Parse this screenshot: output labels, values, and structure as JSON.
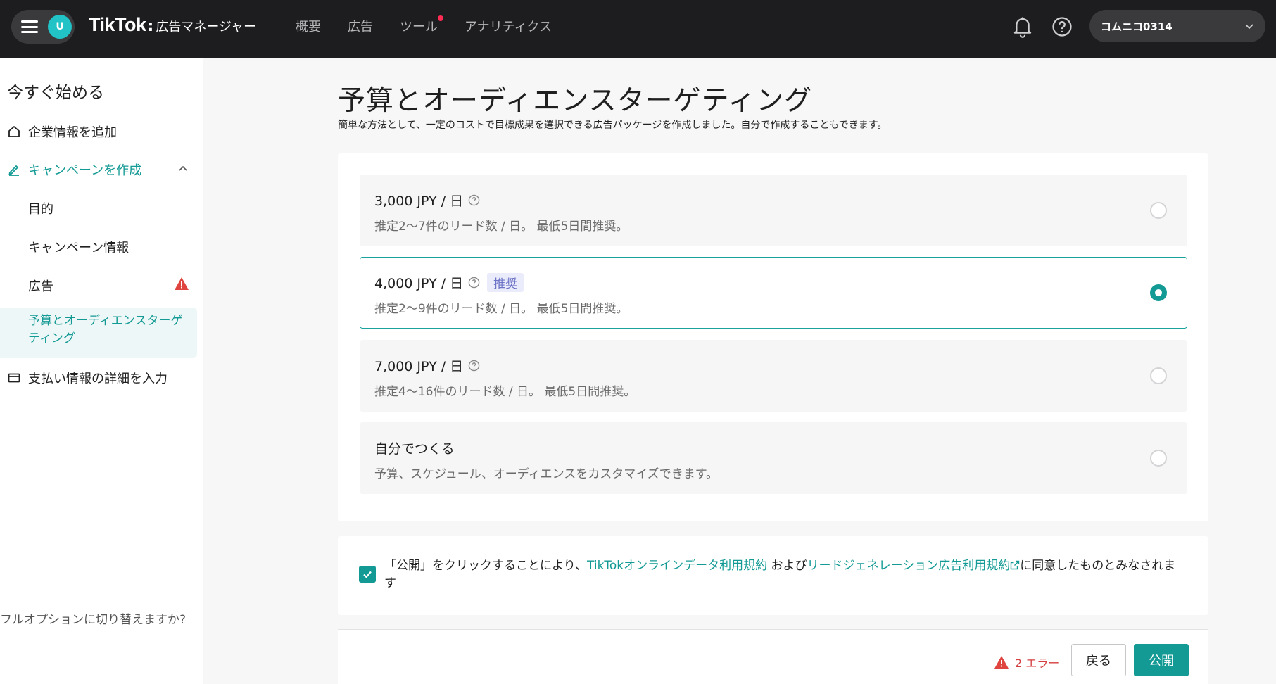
{
  "header": {
    "avatar_letter": "U",
    "brand_name": "TikTok",
    "brand_separator": ":",
    "brand_sub": "広告マネージャー",
    "nav": [
      "概要",
      "広告",
      "ツール",
      "アナリティクス"
    ],
    "account_name": "コムニコ0314",
    "icons": [
      "menu-icon",
      "bell-icon",
      "help-icon",
      "chevron-down-icon"
    ]
  },
  "sidebar": {
    "title": "今すぐ始める",
    "company_info": "企業情報を追加",
    "create_campaign": "キャンペーンを作成",
    "sub_items": [
      "目的",
      "キャンペーン情報",
      "広告"
    ],
    "active_item": "予算とオーディエンスターゲティング",
    "payment": "支払い情報の詳細を入力",
    "switch_text": "フルオプションに切り替えますか?"
  },
  "main": {
    "title": "予算とオーディエンスターゲティング",
    "subtitle": "簡単な方法として、一定のコストで目標成果を選択できる広告パッケージを作成しました。自分で作成することもできます。",
    "options": [
      {
        "title": "3,000 JPY / 日",
        "desc": "推定2～7件のリード数 / 日。 最低5日間推奨。",
        "selected": false
      },
      {
        "title": "4,000 JPY / 日",
        "badge": "推奨",
        "desc": "推定2～9件のリード数 / 日。 最低5日間推奨。",
        "selected": true
      },
      {
        "title": "7,000 JPY / 日",
        "desc": "推定4～16件のリード数 / 日。 最低5日間推奨。",
        "selected": false
      },
      {
        "title": "自分でつくる",
        "desc": "予算、スケジュール、オーディエンスをカスタマイズできます。",
        "selected": false
      }
    ],
    "consent": {
      "checked": true,
      "prefix": "「公開」をクリックすることにより、",
      "link1": "TikTokオンラインデータ利用規約",
      "middle": " および",
      "link2": "リードジェネレーション広告利用規約",
      "suffix": "に同意したものとみなされます"
    },
    "footer": {
      "error_text": "2 エラー",
      "back_label": "戻る",
      "publish_label": "公開"
    }
  },
  "colors": {
    "accent": "#139a94",
    "topbar": "#1d1d1f",
    "error": "#d43e3e",
    "badge_bg": "#eaecfb"
  }
}
